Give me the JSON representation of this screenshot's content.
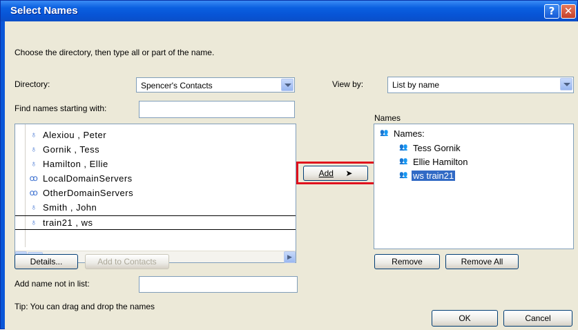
{
  "window": {
    "title": "Select Names",
    "help_label": "?",
    "close_label": "✕"
  },
  "instruction": "Choose the directory, then type all or part of the name.",
  "directory": {
    "label": "Directory:",
    "value": "Spencer's Contacts"
  },
  "find": {
    "label": "Find names starting with:",
    "value": ""
  },
  "view_by": {
    "label": "View by:",
    "value": "List by name"
  },
  "contacts": [
    {
      "name": "Alexiou , Peter",
      "icon": "person-icon"
    },
    {
      "name": "Gornik , Tess",
      "icon": "person-icon"
    },
    {
      "name": "Hamilton , Ellie",
      "icon": "person-icon"
    },
    {
      "name": "LocalDomainServers",
      "icon": "group-icon"
    },
    {
      "name": "OtherDomainServers",
      "icon": "group-icon"
    },
    {
      "name": "Smith , John",
      "icon": "person-icon"
    },
    {
      "name": "train21 , ws",
      "icon": "person-icon"
    }
  ],
  "add_button": {
    "label": "Add",
    "arrow": "➤"
  },
  "names_panel": {
    "label": "Names",
    "root": "Names:",
    "items": [
      "Tess Gornik",
      "Ellie Hamilton",
      "ws train21"
    ],
    "selected_index": 2
  },
  "details_button": "Details...",
  "add_to_contacts_button": "Add to Contacts",
  "remove_button": "Remove",
  "remove_all_button": "Remove All",
  "add_not_in_list": {
    "label": "Add name not in list:",
    "value": ""
  },
  "tip": "Tip: You can drag and drop the names",
  "ok_button": "OK",
  "cancel_button": "Cancel",
  "colors": {
    "title_bar": "#0a5fe0",
    "dialog_bg": "#ece9d8",
    "selection": "#316ac5",
    "highlight_box": "#e0101c"
  }
}
